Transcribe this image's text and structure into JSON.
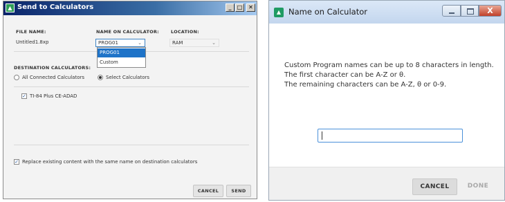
{
  "send_dialog": {
    "title": "Send to Calculators",
    "icon": "ti-connect-icon",
    "window_buttons": {
      "minimize": "_",
      "maximize": "□",
      "close": "✕"
    },
    "columns": {
      "file_name": "FILE NAME:",
      "name_on_calculator": "NAME ON CALCULATOR:",
      "location": "LOCATION:"
    },
    "row": {
      "file_name": "Untitled1.8xp",
      "name_on_calculator": "PROG01",
      "location": "RAM"
    },
    "name_dropdown": {
      "options": [
        "PROG01",
        "Custom"
      ],
      "highlighted": "PROG01"
    },
    "destination": {
      "heading": "DESTINATION CALCULATORS:",
      "options": [
        "All Connected Calculators",
        "Select Calculators"
      ],
      "selected": "Select Calculators"
    },
    "calculators": [
      {
        "name": "TI-84 Plus CE-ADAD",
        "checked": true
      }
    ],
    "replace_option": {
      "label": "Replace existing content with the same name on destination calculators",
      "checked": true
    },
    "buttons": {
      "cancel": "CANCEL",
      "send": "SEND"
    }
  },
  "name_dialog": {
    "title": "Name on Calculator",
    "icon": "ti-connect-icon",
    "instructions": [
      "Custom Program names can be up to 8 characters in length.",
      "The first character can be A-Z or θ.",
      "The remaining characters can be A-Z, θ or 0-9."
    ],
    "input_value": "",
    "buttons": {
      "cancel": "CANCEL",
      "done": "DONE"
    },
    "close_glyph": "X"
  },
  "colors": {
    "accent": "#1e73c8",
    "left_titlebar": "#0a246a",
    "right_titlebar": "#c3d6ee",
    "close_red": "#c1412a",
    "input_focus": "#4a90d9"
  }
}
